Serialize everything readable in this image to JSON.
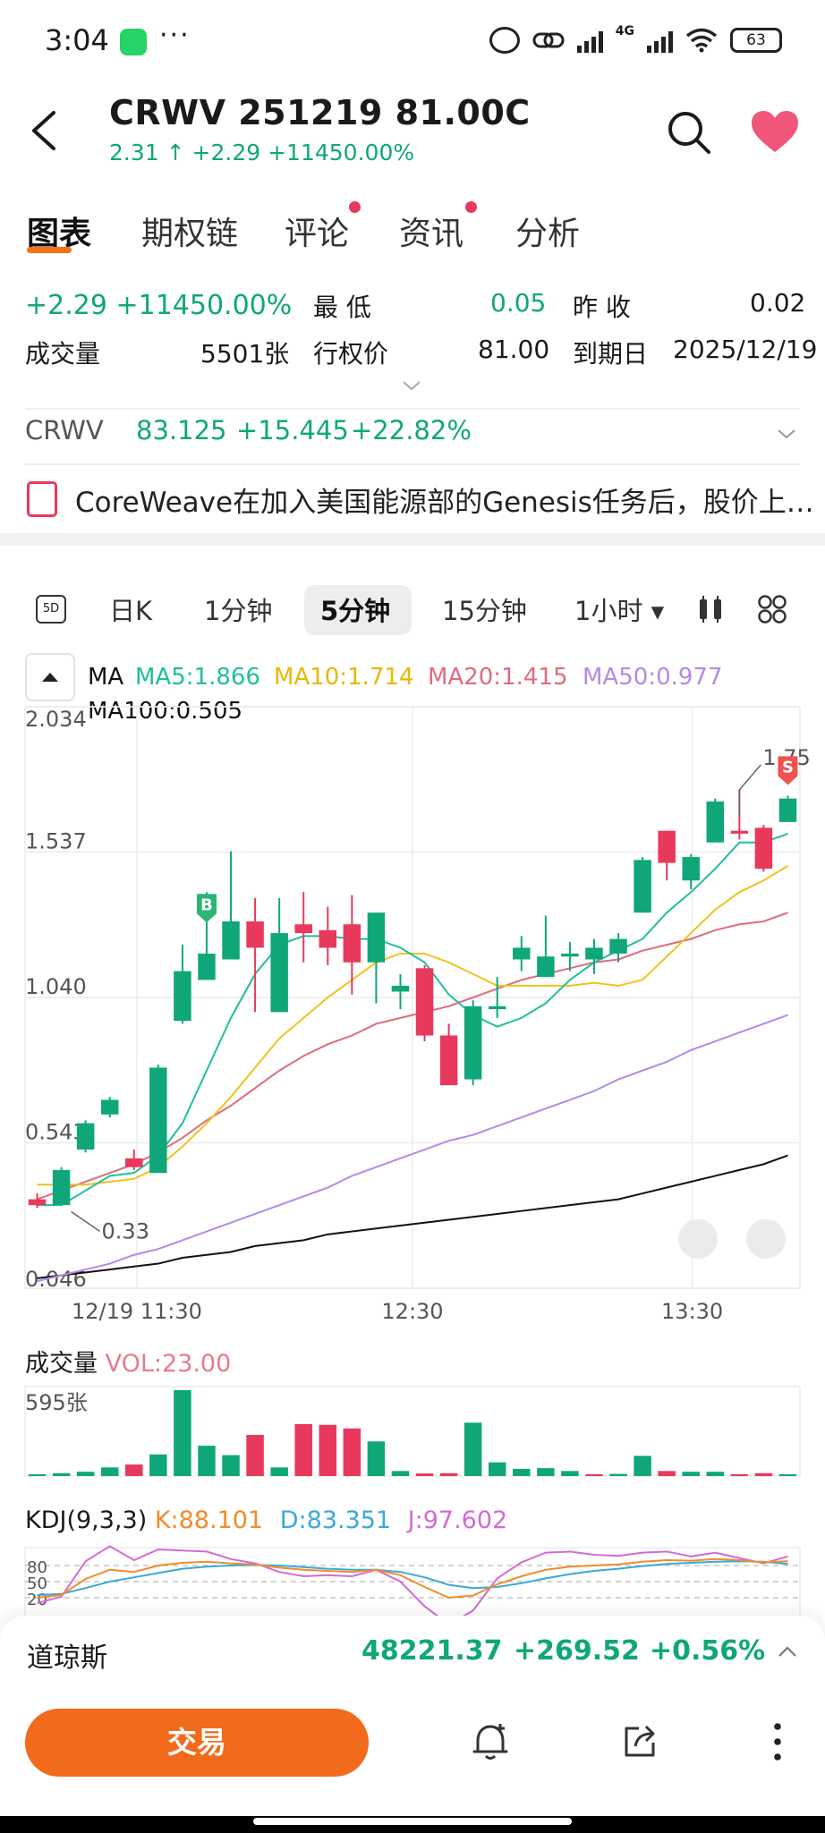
{
  "status_bar": {
    "time": "3:04",
    "more": "···",
    "network": "4G",
    "battery": "63"
  },
  "header": {
    "title": "CRWV 251219 81.00C",
    "price": "2.31",
    "arrow": "↑",
    "change": "+2.29",
    "change_pct": "+11450.00%"
  },
  "tabs": [
    {
      "label": "图表",
      "dot": false
    },
    {
      "label": "期权链",
      "dot": false
    },
    {
      "label": "评论",
      "dot": true
    },
    {
      "label": "资讯",
      "dot": true
    },
    {
      "label": "分析",
      "dot": false
    }
  ],
  "stats": {
    "change": "+2.29",
    "change_pct": "+11450.00%",
    "low_label": "最  低",
    "low_value": "0.05",
    "prev_close_label": "昨  收",
    "prev_close_value": "0.02",
    "volume_label": "成交量",
    "volume_value": "5501张",
    "strike_label": "行权价",
    "strike_value": "81.00",
    "expiry_label": "到期日",
    "expiry_value": "2025/12/19"
  },
  "underlying": {
    "symbol": "CRWV",
    "price": "83.125",
    "change": "+15.445",
    "change_pct": "+22.82%"
  },
  "news": {
    "text": "CoreWeave在加入美国能源部的Genesis任务后，股价上…"
  },
  "timeframes": {
    "five_d": "5D",
    "items": [
      "日K",
      "1分钟",
      "5分钟",
      "15分钟",
      "1小时 ▾"
    ],
    "active_index": 2
  },
  "ma_legend": {
    "ma": "MA",
    "ma5": "MA5:1.866",
    "ma10": "MA10:1.714",
    "ma20": "MA20:1.415",
    "ma50": "MA50:0.977",
    "ma100": "MA100:0.505"
  },
  "colors": {
    "up": "#0fa77a",
    "down": "#e8395c",
    "accent": "#f26b1d",
    "ma5": "#1fbf9e",
    "ma10": "#f2c21b",
    "ma20": "#e06b7d",
    "ma50": "#b48ae6",
    "ma100": "#111111"
  },
  "chart_data": {
    "type": "candlestick",
    "y_ticks": [
      "2.034",
      "1.537",
      "1.040",
      "0.543",
      "0.046"
    ],
    "ylim": [
      0.046,
      2.034
    ],
    "x_ticks": [
      "12/19 11:30",
      "12:30",
      "13:30"
    ],
    "annotations": {
      "high": "1.75",
      "low": "0.33",
      "buy_marker": "B",
      "sell_marker": "S"
    },
    "candles": [
      [
        0.35,
        0.33,
        0.37,
        0.32
      ],
      [
        0.33,
        0.45,
        0.46,
        0.33
      ],
      [
        0.52,
        0.61,
        0.62,
        0.51
      ],
      [
        0.64,
        0.69,
        0.7,
        0.63
      ],
      [
        0.49,
        0.46,
        0.52,
        0.45
      ],
      [
        0.44,
        0.8,
        0.81,
        0.44
      ],
      [
        0.96,
        1.13,
        1.22,
        0.95
      ],
      [
        1.1,
        1.19,
        1.4,
        1.1
      ],
      [
        1.17,
        1.3,
        1.54,
        1.17
      ],
      [
        1.3,
        1.21,
        1.38,
        0.99
      ],
      [
        0.99,
        1.26,
        1.38,
        0.99
      ],
      [
        1.29,
        1.26,
        1.4,
        1.16
      ],
      [
        1.27,
        1.21,
        1.35,
        1.15
      ],
      [
        1.29,
        1.16,
        1.39,
        1.05
      ],
      [
        1.16,
        1.33,
        1.33,
        1.02
      ],
      [
        1.06,
        1.08,
        1.12,
        1.0
      ],
      [
        1.14,
        0.91,
        1.15,
        0.89
      ],
      [
        0.91,
        0.74,
        0.95,
        0.74
      ],
      [
        0.76,
        1.01,
        1.03,
        0.74
      ],
      [
        1.0,
        1.01,
        1.11,
        0.97
      ],
      [
        1.17,
        1.21,
        1.25,
        1.13
      ],
      [
        1.11,
        1.18,
        1.32,
        1.11
      ],
      [
        1.18,
        1.19,
        1.23,
        1.13
      ],
      [
        1.17,
        1.21,
        1.24,
        1.12
      ],
      [
        1.19,
        1.24,
        1.26,
        1.16
      ],
      [
        1.33,
        1.51,
        1.52,
        1.33
      ],
      [
        1.61,
        1.5,
        1.61,
        1.44
      ],
      [
        1.44,
        1.52,
        1.53,
        1.41
      ],
      [
        1.57,
        1.71,
        1.72,
        1.57
      ],
      [
        1.61,
        1.6,
        1.75,
        1.58
      ],
      [
        1.62,
        1.48,
        1.63,
        1.47
      ],
      [
        1.64,
        1.72,
        1.73,
        1.64
      ]
    ],
    "ma5": [
      0.33,
      0.33,
      0.38,
      0.43,
      0.44,
      0.5,
      0.61,
      0.79,
      0.97,
      1.12,
      1.22,
      1.25,
      1.25,
      1.24,
      1.24,
      1.21,
      1.16,
      1.05,
      0.98,
      0.94,
      0.97,
      1.02,
      1.1,
      1.16,
      1.2,
      1.24,
      1.33,
      1.4,
      1.48,
      1.57,
      1.57,
      1.6
    ],
    "ma10": [
      0.4,
      0.4,
      0.4,
      0.41,
      0.42,
      0.46,
      0.53,
      0.61,
      0.7,
      0.8,
      0.9,
      0.97,
      1.04,
      1.1,
      1.16,
      1.19,
      1.19,
      1.16,
      1.12,
      1.08,
      1.08,
      1.08,
      1.08,
      1.09,
      1.08,
      1.1,
      1.18,
      1.26,
      1.34,
      1.4,
      1.44,
      1.49
    ],
    "ma20": [
      0.35,
      0.38,
      0.41,
      0.44,
      0.47,
      0.51,
      0.56,
      0.62,
      0.67,
      0.73,
      0.79,
      0.84,
      0.88,
      0.91,
      0.95,
      0.97,
      0.99,
      1.01,
      1.04,
      1.07,
      1.1,
      1.12,
      1.14,
      1.16,
      1.17,
      1.2,
      1.22,
      1.24,
      1.27,
      1.29,
      1.3,
      1.33
    ],
    "ma50": [
      0.07,
      0.09,
      0.11,
      0.13,
      0.16,
      0.18,
      0.21,
      0.24,
      0.27,
      0.3,
      0.33,
      0.36,
      0.39,
      0.43,
      0.46,
      0.49,
      0.52,
      0.55,
      0.57,
      0.6,
      0.63,
      0.66,
      0.69,
      0.72,
      0.76,
      0.79,
      0.82,
      0.86,
      0.89,
      0.92,
      0.95,
      0.98
    ],
    "ma100": [
      0.08,
      0.09,
      0.1,
      0.11,
      0.12,
      0.13,
      0.15,
      0.16,
      0.17,
      0.19,
      0.2,
      0.21,
      0.23,
      0.24,
      0.25,
      0.26,
      0.27,
      0.28,
      0.29,
      0.3,
      0.31,
      0.32,
      0.33,
      0.34,
      0.35,
      0.37,
      0.39,
      0.41,
      0.43,
      0.45,
      0.47,
      0.5
    ],
    "volume": {
      "label": "成交量",
      "vol_text": "VOL:23.00",
      "max_label": "595张",
      "max": 595,
      "values": [
        10,
        20,
        30,
        60,
        80,
        150,
        595,
        210,
        145,
        285,
        60,
        360,
        355,
        330,
        240,
        35,
        18,
        20,
        370,
        95,
        50,
        55,
        35,
        5,
        15,
        140,
        35,
        30,
        30,
        5,
        20,
        5
      ],
      "up": [
        true,
        true,
        true,
        true,
        false,
        true,
        true,
        true,
        true,
        false,
        true,
        false,
        false,
        false,
        true,
        true,
        false,
        false,
        true,
        true,
        true,
        true,
        true,
        false,
        true,
        true,
        false,
        true,
        true,
        false,
        false,
        true
      ]
    },
    "kdj": {
      "label": "KDJ(9,3,3)",
      "k_text": "K:88.101",
      "d_text": "D:83.351",
      "j_text": "J:97.602",
      "levels": [
        "80",
        "50",
        "20"
      ],
      "k": [
        20,
        25,
        55,
        72,
        68,
        80,
        85,
        87,
        84,
        82,
        76,
        72,
        70,
        68,
        72,
        62,
        40,
        20,
        24,
        45,
        60,
        72,
        78,
        80,
        82,
        87,
        90,
        89,
        92,
        90,
        86,
        88
      ],
      "d": [
        25,
        27,
        38,
        50,
        58,
        66,
        74,
        78,
        80,
        81,
        80,
        77,
        74,
        72,
        72,
        68,
        58,
        44,
        38,
        40,
        47,
        56,
        64,
        70,
        74,
        79,
        83,
        85,
        87,
        88,
        87,
        83
      ],
      "j": [
        10,
        22,
        88,
        116,
        90,
        110,
        108,
        106,
        92,
        84,
        68,
        60,
        62,
        60,
        72,
        50,
        4,
        -30,
        -4,
        56,
        86,
        104,
        106,
        100,
        98,
        104,
        106,
        97,
        104,
        94,
        84,
        97
      ]
    }
  },
  "bottom": {
    "index_name": "道琼斯",
    "index_value": "48221.37",
    "index_change": "+269.52",
    "index_pct": "+0.56%",
    "trade_label": "交易"
  }
}
